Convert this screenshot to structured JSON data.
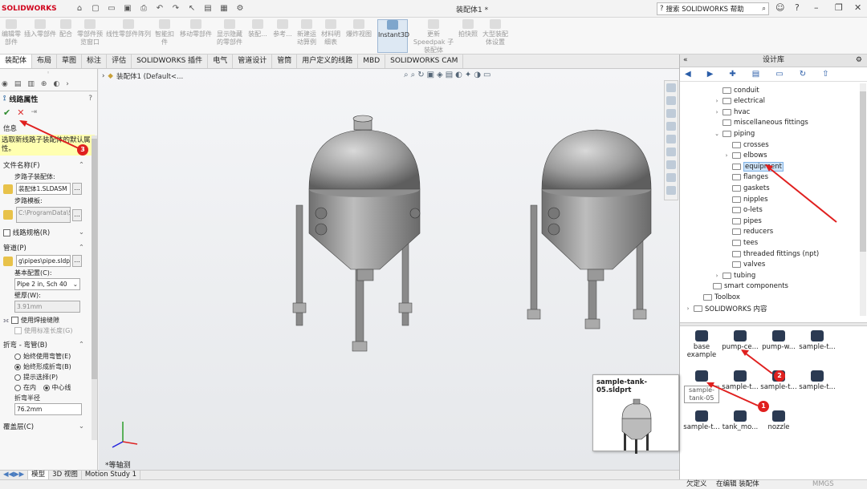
{
  "app": {
    "logo": "SOLIDWORKS",
    "doc_title": "装配体1 *",
    "search_placeholder": "搜索 SOLIDWORKS 帮助",
    "accent": "#d0021b"
  },
  "ribbon": {
    "items": [
      {
        "label": "编辑零部件",
        "name": "edit-component"
      },
      {
        "label": "插入零部件",
        "name": "insert-component"
      },
      {
        "label": "配合",
        "name": "mate"
      },
      {
        "label": "零部件预览窗口",
        "name": "component-preview"
      },
      {
        "label": "线性零部件阵列",
        "name": "linear-pattern"
      },
      {
        "label": "智能扣件",
        "name": "smart-fasteners"
      },
      {
        "label": "移动零部件",
        "name": "move-component"
      },
      {
        "label": "显示隐藏的零部件",
        "name": "show-hidden"
      },
      {
        "label": "装配...",
        "name": "assembly-features"
      },
      {
        "label": "参考...",
        "name": "reference-geometry"
      },
      {
        "label": "新建运动算例",
        "name": "new-motion-study"
      },
      {
        "label": "材料明细表",
        "name": "bom"
      },
      {
        "label": "爆炸视图",
        "name": "exploded-view"
      },
      {
        "label": "Instant3D",
        "name": "instant3d"
      },
      {
        "label": "更新 Speedpak 子装配体",
        "name": "update-speedpak"
      },
      {
        "label": "拍快照",
        "name": "take-snapshot"
      },
      {
        "label": "大型装配体设置",
        "name": "large-assembly"
      }
    ]
  },
  "tabs": [
    "装配体",
    "布局",
    "草图",
    "标注",
    "评估",
    "SOLIDWORKS 插件",
    "电气",
    "管道设计",
    "管筒",
    "用户定义的线路",
    "MBD",
    "SOLIDWORKS CAM"
  ],
  "property_manager": {
    "title": "线路属性",
    "help": "?",
    "ok": "✔",
    "cancel": "✕",
    "pin": "⇥",
    "info_header": "信息",
    "info_message": "选取新线路子装配体的默认属性。",
    "filename_header": "文件名称(F)",
    "route_sub_label": "步路子装配体:",
    "route_sub_value": "装配体1.SLDASM",
    "route_template_label": "步路模板:",
    "route_template_value": "C:\\ProgramData\\So",
    "route_spec_label": "线路规格(R)",
    "pipe_header": "管道(P)",
    "pipe_value": "g\\pipes\\pipe.sldprt",
    "base_config_label": "基本配置(C):",
    "base_config_value": "Pipe 2 in, Sch 40",
    "wall_label": "壁厚(W):",
    "wall_value": "3.91mm",
    "weld_gap_label": "使用焊接缝隙",
    "std_length_label": "使用标准长度(G)",
    "bend_header": "折弯 - 弯管(B)",
    "radio_always_elbow": "始终使用弯管(E)",
    "radio_always_bend": "始终形成折弯(B)",
    "radio_prompt": "提示选择(P)",
    "radio_inner": "在内",
    "radio_center": "中心线",
    "bend_radius_label": "折弯半径",
    "bend_radius_value": "76.2mm",
    "cover_header": "覆盖层(C)"
  },
  "viewport": {
    "crumb": "装配体1  (Default<...",
    "view_label": "*等轴测"
  },
  "design_library": {
    "title": "设计库",
    "tree": [
      {
        "label": "conduit",
        "indent": 3,
        "expander": ""
      },
      {
        "label": "electrical",
        "indent": 3,
        "expander": ">"
      },
      {
        "label": "hvac",
        "indent": 3,
        "expander": ">"
      },
      {
        "label": "miscellaneous fittings",
        "indent": 3,
        "expander": ""
      },
      {
        "label": "piping",
        "indent": 3,
        "expander": "v"
      },
      {
        "label": "crosses",
        "indent": 4,
        "expander": ""
      },
      {
        "label": "elbows",
        "indent": 4,
        "expander": ">"
      },
      {
        "label": "equipment",
        "indent": 4,
        "expander": "",
        "selected": true
      },
      {
        "label": "flanges",
        "indent": 4,
        "expander": ""
      },
      {
        "label": "gaskets",
        "indent": 4,
        "expander": ""
      },
      {
        "label": "nipples",
        "indent": 4,
        "expander": ""
      },
      {
        "label": "o-lets",
        "indent": 4,
        "expander": ""
      },
      {
        "label": "pipes",
        "indent": 4,
        "expander": ""
      },
      {
        "label": "reducers",
        "indent": 4,
        "expander": ""
      },
      {
        "label": "tees",
        "indent": 4,
        "expander": ""
      },
      {
        "label": "threaded fittings (npt)",
        "indent": 4,
        "expander": ""
      },
      {
        "label": "valves",
        "indent": 4,
        "expander": ""
      },
      {
        "label": "tubing",
        "indent": 3,
        "expander": ">"
      },
      {
        "label": "smart components",
        "indent": 2,
        "expander": ""
      },
      {
        "label": "Toolbox",
        "indent": 1,
        "expander": ""
      },
      {
        "label": "SOLIDWORKS 内容",
        "indent": 0,
        "expander": ">"
      }
    ],
    "parts": [
      {
        "label": "base example",
        "row": 0,
        "col": 0
      },
      {
        "label": "pump-ce...",
        "row": 0,
        "col": 1
      },
      {
        "label": "pump-w...",
        "row": 0,
        "col": 2
      },
      {
        "label": "sample-t...",
        "row": 0,
        "col": 3
      },
      {
        "label": "",
        "row": 1,
        "col": 0
      },
      {
        "label": "sample-t...",
        "row": 1,
        "col": 1
      },
      {
        "label": "sample-t...",
        "row": 1,
        "col": 2
      },
      {
        "label": "sample-t...",
        "row": 1,
        "col": 3
      },
      {
        "label": "sample-t...",
        "row": 2,
        "col": 0
      },
      {
        "label": "tank_mo...",
        "row": 2,
        "col": 1
      },
      {
        "label": "nozzle",
        "row": 2,
        "col": 2
      }
    ],
    "tooltip": "sample-tank-05",
    "preview_title": "sample-tank-05.sldprt"
  },
  "bottom_tabs": [
    "模型",
    "3D 视图",
    "Motion Study 1"
  ],
  "status": {
    "left": "欠定义",
    "middle": "在编辑 装配体",
    "units": "MMGS"
  },
  "annotations": [
    "1",
    "2",
    "3"
  ]
}
